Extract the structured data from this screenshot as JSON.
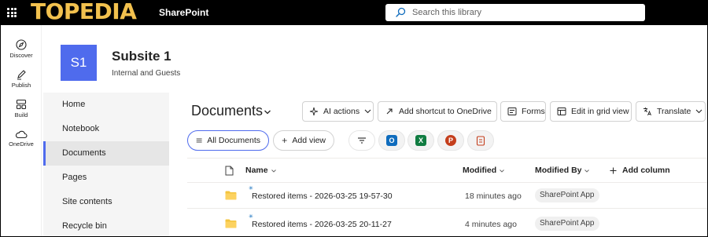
{
  "topbar": {
    "brand": "TOPEDIA",
    "suite_name": "SharePoint",
    "search_placeholder": "Search this library"
  },
  "appbar": {
    "items": [
      {
        "label": "Discover",
        "icon": "compass-icon"
      },
      {
        "label": "Publish",
        "icon": "pen-icon"
      },
      {
        "label": "Build",
        "icon": "grid-icon"
      },
      {
        "label": "OneDrive",
        "icon": "cloud-icon"
      }
    ]
  },
  "site": {
    "logo_text": "S1",
    "title": "Subsite 1",
    "subtitle": "Internal and Guests",
    "logo_color": "#4f6bed"
  },
  "leftnav": {
    "items": [
      {
        "label": "Home",
        "active": false
      },
      {
        "label": "Notebook",
        "active": false
      },
      {
        "label": "Documents",
        "active": true
      },
      {
        "label": "Pages",
        "active": false
      },
      {
        "label": "Site contents",
        "active": false
      },
      {
        "label": "Recycle bin",
        "active": false
      }
    ]
  },
  "library": {
    "title": "Documents",
    "commands": {
      "ai_actions": "AI actions",
      "add_shortcut": "Add shortcut to OneDrive",
      "forms": "Forms",
      "edit_grid": "Edit in grid view",
      "translate": "Translate"
    },
    "views": {
      "all_documents": "All Documents",
      "add_view": "Add view"
    },
    "columns": {
      "name": "Name",
      "modified": "Modified",
      "modified_by": "Modified By",
      "add_column": "Add column"
    },
    "rows": [
      {
        "name": "Restored items - 2026-03-25 19-57-30",
        "modified": "18 minutes ago",
        "modified_by": "SharePoint App"
      },
      {
        "name": "Restored items - 2026-03-25 20-11-27",
        "modified": "4 minutes ago",
        "modified_by": "SharePoint App"
      }
    ]
  },
  "colors": {
    "accent": "#4f6bed",
    "folder": "#f3c43e",
    "brand_text": "#f2c14e"
  }
}
